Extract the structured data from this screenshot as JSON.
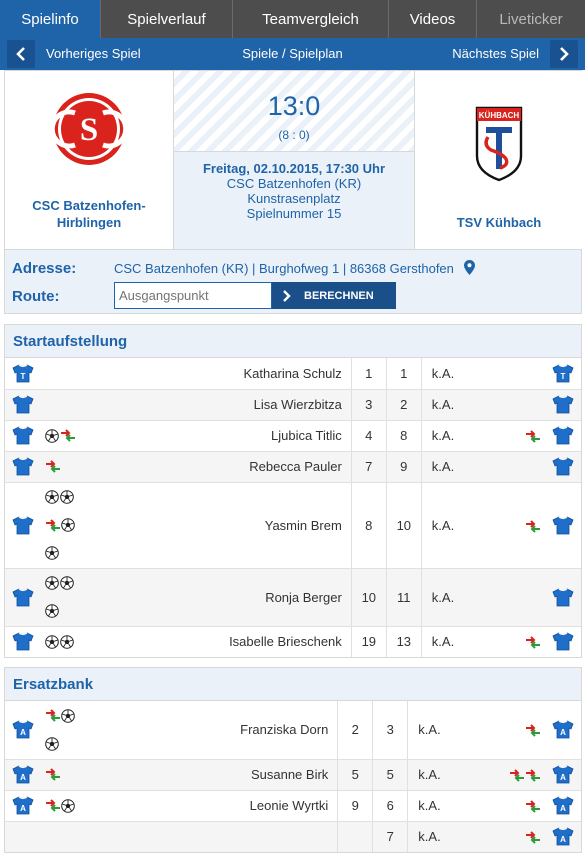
{
  "tabs": [
    {
      "label": "Spielinfo"
    },
    {
      "label": "Spielverlauf"
    },
    {
      "label": "Teamvergleich"
    },
    {
      "label": "Videos"
    },
    {
      "label": "Liveticker"
    }
  ],
  "nav": {
    "prev": "Vorheriges Spiel",
    "center": "Spiele / Spielplan",
    "next": "Nächstes Spiel"
  },
  "match": {
    "home_line1": "CSC Batzenhofen-",
    "home_line2": "Hirblingen",
    "away": "TSV Kühbach",
    "away_logo_text": "KÜHBACH",
    "score": "13:0",
    "halftime": "(8 : 0)",
    "date": "Freitag, 02.10.2015, 17:30 Uhr",
    "venue_line1": "CSC Batzenhofen (KR)",
    "venue_line2": "Kunstrasenplatz",
    "match_number": "Spielnummer 15"
  },
  "address": {
    "label": "Adresse:",
    "value": "CSC Batzenhofen (KR)  |  Burghofweg 1  |  86368 Gersthofen",
    "route_label": "Route:",
    "route_placeholder": "Ausgangspunkt",
    "button": "BERECHNEN"
  },
  "colors": {
    "accent": "#1f63a8",
    "tab_bar": "#4d4d4d",
    "light_bg": "#eaf1f9"
  },
  "lineup": {
    "title": "Startaufstellung",
    "rows": [
      {
        "left_icons": [],
        "name": "Katharina Schulz",
        "n1": "1",
        "n2": "1",
        "info": "k.A.",
        "right_icons": []
      },
      {
        "left_icons": [],
        "name": "Lisa Wierzbitza",
        "n1": "3",
        "n2": "2",
        "info": "k.A.",
        "right_icons": []
      },
      {
        "left_icons": [
          "ball",
          "sub"
        ],
        "name": "Ljubica Titlic",
        "n1": "4",
        "n2": "8",
        "info": "k.A.",
        "right_icons": [
          "sub"
        ]
      },
      {
        "left_icons": [
          "sub"
        ],
        "name": "Rebecca Pauler",
        "n1": "7",
        "n2": "9",
        "info": "k.A.",
        "right_icons": []
      },
      {
        "left_icons": [
          "ball",
          "ball",
          "sub",
          "ball",
          "ball"
        ],
        "name": "Yasmin Brem",
        "n1": "8",
        "n2": "10",
        "info": "k.A.",
        "right_icons": [
          "sub"
        ]
      },
      {
        "left_icons": [
          "ball",
          "ball",
          "ball"
        ],
        "name": "Ronja Berger",
        "n1": "10",
        "n2": "11",
        "info": "k.A.",
        "right_icons": []
      },
      {
        "left_icons": [
          "ball",
          "ball"
        ],
        "name": "Isabelle Brieschenk",
        "n1": "19",
        "n2": "13",
        "info": "k.A.",
        "right_icons": [
          "sub"
        ]
      }
    ]
  },
  "bench": {
    "title": "Ersatzbank",
    "rows": [
      {
        "left_icons": [
          "sub",
          "ball",
          "ball"
        ],
        "name": "Franziska Dorn",
        "n1": "2",
        "n2": "3",
        "info": "k.A.",
        "right_icons": [
          "sub"
        ]
      },
      {
        "left_icons": [
          "sub"
        ],
        "name": "Susanne Birk",
        "n1": "5",
        "n2": "5",
        "info": "k.A.",
        "right_icons": [
          "sub",
          "sub"
        ]
      },
      {
        "left_icons": [
          "sub",
          "ball"
        ],
        "name": "Leonie Wyrtki",
        "n1": "9",
        "n2": "6",
        "info": "k.A.",
        "right_icons": [
          "sub"
        ]
      },
      {
        "left_icons": [],
        "name": "",
        "n1": "",
        "n2": "7",
        "info": "k.A.",
        "right_icons": [
          "sub"
        ]
      }
    ]
  }
}
